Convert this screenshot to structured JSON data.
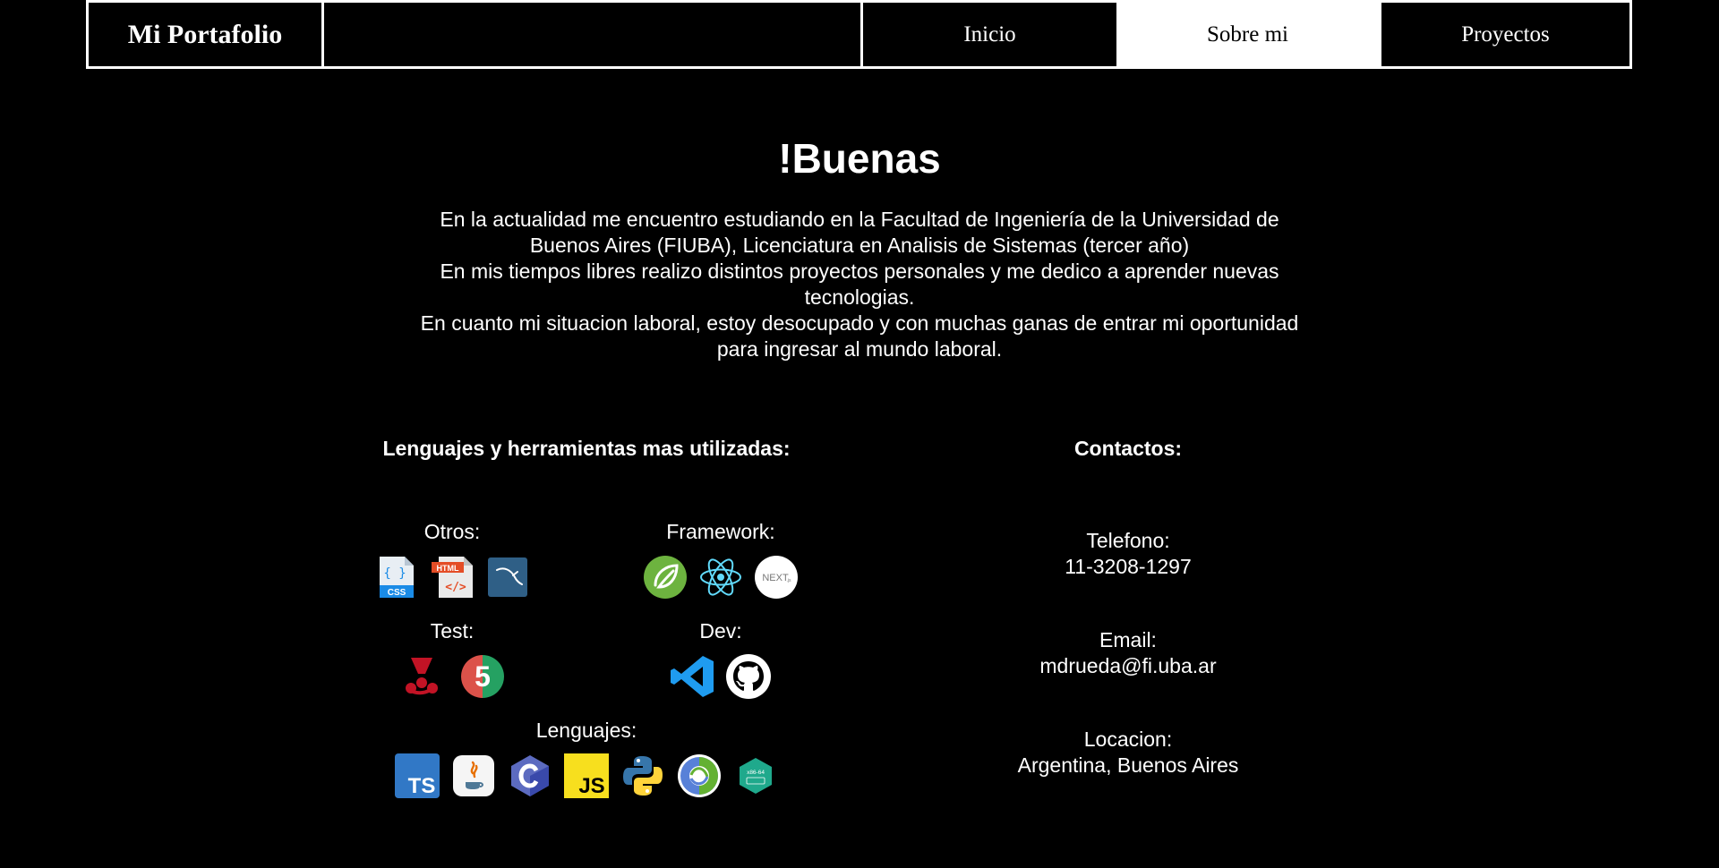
{
  "nav": {
    "brand": "Mi Portafolio",
    "items": [
      {
        "label": "Inicio"
      },
      {
        "label": "Sobre mi",
        "active": true
      },
      {
        "label": "Proyectos"
      }
    ]
  },
  "intro": {
    "greeting": "!Buenas",
    "lines": [
      "En la actualidad me encuentro estudiando en la Facultad de Ingeniería de la Universidad de Buenos Aires (FIUBA), Licenciatura en Analisis de Sistemas (tercer año)",
      "En mis tiempos libres realizo distintos proyectos personales y me dedico a aprender nuevas tecnologias.",
      "En cuanto mi situacion laboral, estoy desocupado y con muchas ganas de entrar mi oportunidad para ingresar al mundo laboral."
    ]
  },
  "tools": {
    "title": "Lenguajes y herramientas mas utilizadas:",
    "groups": {
      "otros": {
        "label": "Otros:",
        "icons": [
          "css-icon",
          "html-icon",
          "mysql-icon"
        ]
      },
      "framework": {
        "label": "Framework:",
        "icons": [
          "spring-icon",
          "react-icon",
          "nextjs-icon"
        ]
      },
      "test": {
        "label": "Test:",
        "icons": [
          "jest-icon",
          "junit5-icon"
        ]
      },
      "dev": {
        "label": "Dev:",
        "icons": [
          "vscode-icon",
          "github-icon"
        ]
      },
      "lenguajes": {
        "label": "Lenguajes:",
        "icons": [
          "typescript-icon",
          "java-icon",
          "c-icon",
          "javascript-icon",
          "python-icon",
          "clojure-icon",
          "assembly-x86-icon"
        ]
      }
    }
  },
  "contacts": {
    "title": "Contactos:",
    "telefono": {
      "label": "Telefono:",
      "value": "11-3208-1297"
    },
    "email": {
      "label": "Email:",
      "value": "mdrueda@fi.uba.ar"
    },
    "locacion": {
      "label": "Locacion:",
      "value": "Argentina, Buenos Aires"
    }
  },
  "icon_texts": {
    "css": "CSS",
    "html": "HTML",
    "next": "NEXT",
    "junit": "5",
    "ts": "TS",
    "js": "JS",
    "asm": "x86-64"
  },
  "colors": {
    "background": "#000000",
    "text": "#ffffff",
    "nav_active_bg": "#ffffff",
    "nav_active_text": "#000000"
  }
}
